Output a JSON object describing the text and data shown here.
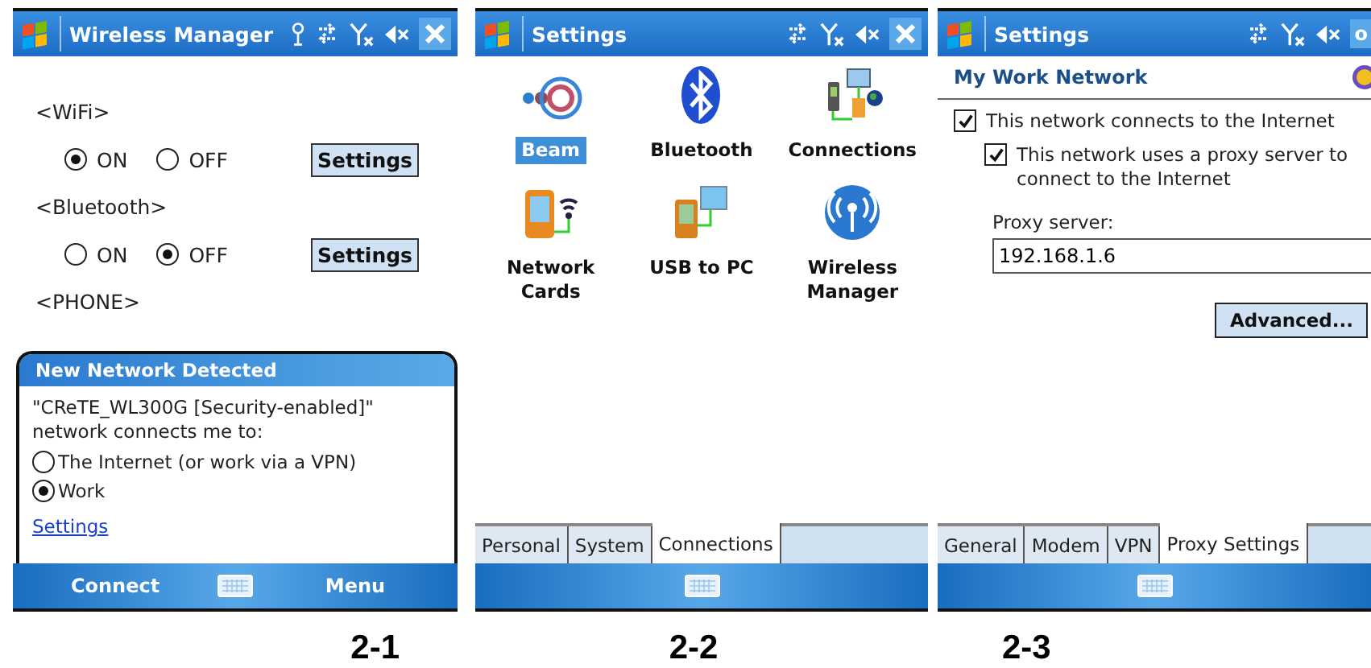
{
  "panels": [
    {
      "kind": "wireless",
      "caption": "2-1",
      "title_bar": {
        "title": "Wireless Manager",
        "antenna": true
      },
      "sections": [
        {
          "label": "<WiFi>",
          "options": [
            {
              "label": "ON",
              "selected": true
            },
            {
              "label": "OFF",
              "selected": false
            }
          ],
          "button": "Settings"
        },
        {
          "label": "<Bluetooth>",
          "options": [
            {
              "label": "ON",
              "selected": false
            },
            {
              "label": "OFF",
              "selected": true
            }
          ],
          "button": "Settings"
        },
        {
          "label": "<PHONE>"
        }
      ],
      "dialog": {
        "title": "New Network Detected",
        "message": "\"CReTE_WL300G [Security-enabled]\" network connects me to:",
        "options": [
          {
            "label": "The Internet (or work via a VPN)",
            "selected": false
          },
          {
            "label": "Work",
            "selected": true
          }
        ],
        "link": "Settings"
      },
      "softkeys": [
        "Connect",
        "Menu"
      ]
    },
    {
      "kind": "settings-grid",
      "caption": "2-2",
      "title_bar": {
        "title": "Settings",
        "antenna": false
      },
      "items": [
        {
          "label": "Beam",
          "selected": true
        },
        {
          "label": "Bluetooth",
          "selected": false
        },
        {
          "label": "Connections",
          "selected": false
        },
        {
          "label": "Network Cards",
          "selected": false
        },
        {
          "label": "USB to PC",
          "selected": false
        },
        {
          "label": "Wireless Manager",
          "selected": false
        }
      ],
      "tabs": [
        {
          "label": "Personal",
          "selected": false
        },
        {
          "label": "System",
          "selected": false
        },
        {
          "label": "Connections",
          "selected": true
        }
      ]
    },
    {
      "kind": "network-settings",
      "caption": "2-3",
      "title_bar": {
        "title": "Settings",
        "antenna": false,
        "action_label": "o"
      },
      "heading": "My Work Network",
      "checks": [
        {
          "label": "This network connects to the Internet",
          "checked": true,
          "children": [
            {
              "label": "This network uses a proxy server to connect to the Internet",
              "checked": true
            }
          ]
        }
      ],
      "field": {
        "label": "Proxy server:",
        "value": "192.168.1.6"
      },
      "button": "Advanced...",
      "tabs": [
        {
          "label": "General",
          "selected": false
        },
        {
          "label": "Modem",
          "selected": false
        },
        {
          "label": "VPN",
          "selected": false
        },
        {
          "label": "Proxy Settings",
          "selected": true
        }
      ]
    }
  ]
}
